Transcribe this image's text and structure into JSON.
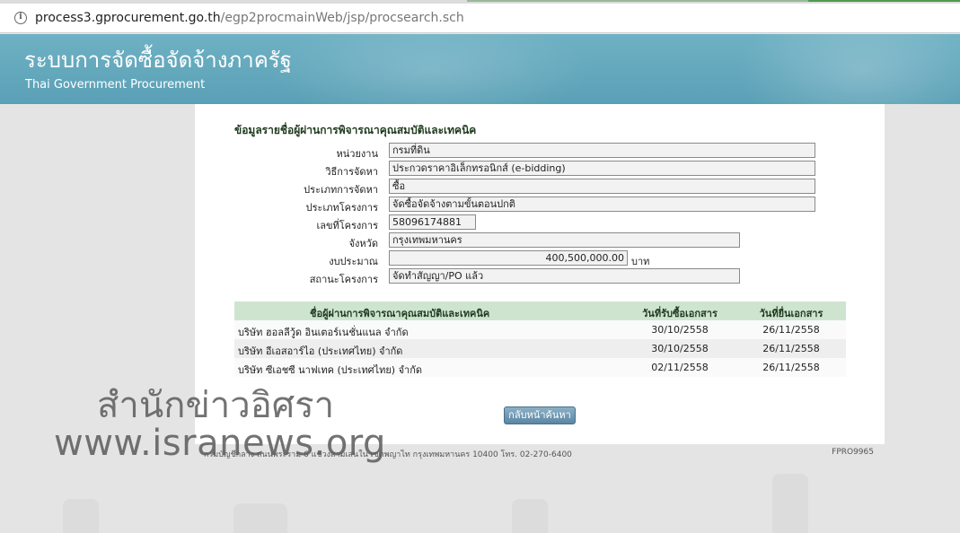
{
  "browser": {
    "url_host": "process3.gprocurement.go.th",
    "url_path": "/egp2procmainWeb/jsp/procsearch.sch"
  },
  "header": {
    "title_th": "ระบบการจัดซื้อจัดจ้างภาครัฐ",
    "title_en": "Thai Government Procurement"
  },
  "panel": {
    "section_title": "ข้อมูลรายชื่อผู้ผ่านการพิจารณาคุณสมบัติและเทคนิค",
    "fields": [
      {
        "label": "หน่วยงาน",
        "value": "กรมที่ดิน"
      },
      {
        "label": "วิธีการจัดหา",
        "value": "ประกวดราคาอิเล็กทรอนิกส์ (e-bidding)"
      },
      {
        "label": "ประเภทการจัดหา",
        "value": "ซื้อ"
      },
      {
        "label": "ประเภทโครงการ",
        "value": "จัดซื้อจัดจ้างตามขั้นตอนปกติ"
      },
      {
        "label": "เลขที่โครงการ",
        "value": "58096174881"
      },
      {
        "label": "จังหวัด",
        "value": "กรุงเทพมหานคร"
      },
      {
        "label": "งบประมาณ",
        "value": "400,500,000.00",
        "unit": "บาท"
      },
      {
        "label": "สถานะโครงการ",
        "value": "จัดทำสัญญา/PO แล้ว"
      }
    ],
    "table": {
      "headers": [
        "ชื่อผู้ผ่านการพิจารณาคุณสมบัติและเทคนิค",
        "วันที่รับซื้อเอกสาร",
        "วันที่ยื่นเอกสาร"
      ],
      "rows": [
        {
          "name": "บริษัท ฮอลลีวู้ด อินเตอร์เนชั่นแนล จำกัด",
          "receive_date": "30/10/2558",
          "submit_date": "26/11/2558"
        },
        {
          "name": "บริษัท อีเอสอาร์ไอ (ประเทศไทย) จำกัด",
          "receive_date": "30/10/2558",
          "submit_date": "26/11/2558"
        },
        {
          "name": "บริษัท ซีเอชซี นาฟเทค (ประเทศไทย) จำกัด",
          "receive_date": "02/11/2558",
          "submit_date": "26/11/2558"
        }
      ]
    },
    "back_button": "กลับหน้าค้นหา"
  },
  "footer": {
    "text": "กรมบัญชีกลาง ถนนพระราม 6 แขวงสามเสนใน เขตพญาไท กรุงเทพมหานคร 10400 โทร. 02-270-6400",
    "code": "FPRO9965"
  },
  "watermark": {
    "line1": "สำนักข่าวอิศรา",
    "line2": "www.isranews.org"
  }
}
